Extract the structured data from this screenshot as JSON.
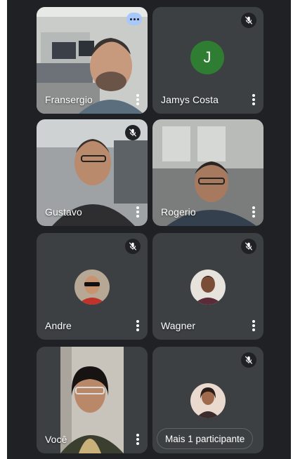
{
  "participants": [
    {
      "name": "Fransergio",
      "active_speaker": true,
      "has_video": true,
      "muted": false
    },
    {
      "name": "Jamys Costa",
      "initial": "J",
      "has_video": false,
      "muted": true,
      "avatar_color": "#2e7d32"
    },
    {
      "name": "Gustavo",
      "has_video": true,
      "muted": true
    },
    {
      "name": "Rogerio",
      "has_video": true,
      "muted": false
    },
    {
      "name": "Andre",
      "has_video": false,
      "muted": true
    },
    {
      "name": "Wagner",
      "has_video": false,
      "muted": true
    },
    {
      "name": "Você",
      "has_video": true,
      "muted": false
    },
    {
      "more_label": "Mais 1 participante",
      "has_video": false,
      "muted": true
    }
  ],
  "colors": {
    "background": "#202124",
    "tile": "#3c4043",
    "active_border": "#a8c7fa"
  },
  "icons": [
    "more-options-icon",
    "mic-off-icon",
    "kebab-menu-icon"
  ]
}
